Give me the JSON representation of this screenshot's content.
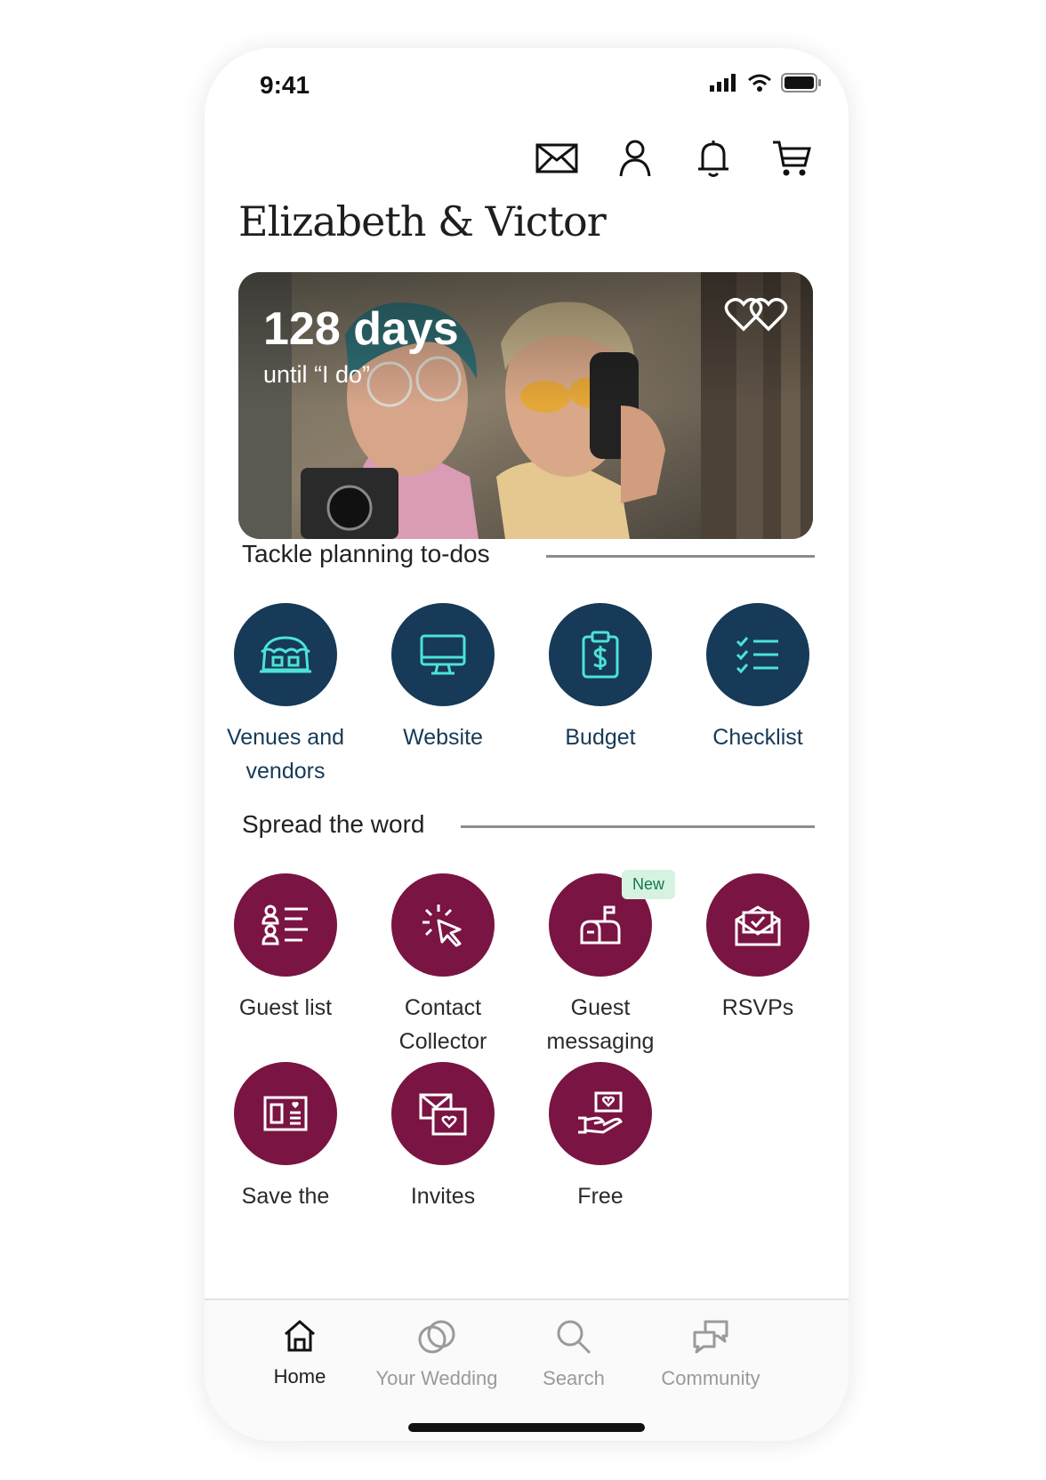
{
  "status_bar": {
    "time": "9:41"
  },
  "header": {
    "title": "Elizabeth & Victor",
    "actions": [
      "mail-icon",
      "profile-icon",
      "bell-icon",
      "cart-icon"
    ]
  },
  "hero": {
    "days": "128 days",
    "subtitle": "until “I do”"
  },
  "sections": {
    "planning": {
      "title": "Tackle planning to-dos",
      "items": [
        {
          "label": "Venues and vendors",
          "icon": "venue-icon"
        },
        {
          "label": "Website",
          "icon": "monitor-icon"
        },
        {
          "label": "Budget",
          "icon": "budget-icon"
        },
        {
          "label": "Checklist",
          "icon": "checklist-icon"
        }
      ]
    },
    "spread": {
      "title": "Spread the word",
      "items": [
        {
          "label": "Guest list",
          "icon": "guest-list-icon"
        },
        {
          "label": "Contact Collector",
          "icon": "cursor-click-icon"
        },
        {
          "label": "Guest messaging",
          "icon": "mailbox-icon",
          "badge": "New"
        },
        {
          "label": "RSVPs",
          "icon": "rsvp-envelope-icon"
        },
        {
          "label": "Save the",
          "icon": "save-the-date-icon"
        },
        {
          "label": "Invites",
          "icon": "invites-icon"
        },
        {
          "label": "Free",
          "icon": "hand-heart-icon"
        }
      ]
    }
  },
  "bottom_nav": [
    {
      "label": "Home",
      "icon": "home-icon",
      "active": true
    },
    {
      "label": "Your Wedding",
      "icon": "rings-icon",
      "active": false
    },
    {
      "label": "Search",
      "icon": "search-icon",
      "active": false
    },
    {
      "label": "Community",
      "icon": "chat-bubbles-icon",
      "active": false
    }
  ],
  "colors": {
    "navy": "#163a57",
    "plum": "#7a1442",
    "icon_accent": "#4de3d6",
    "badge_bg": "#d6f2e0"
  }
}
